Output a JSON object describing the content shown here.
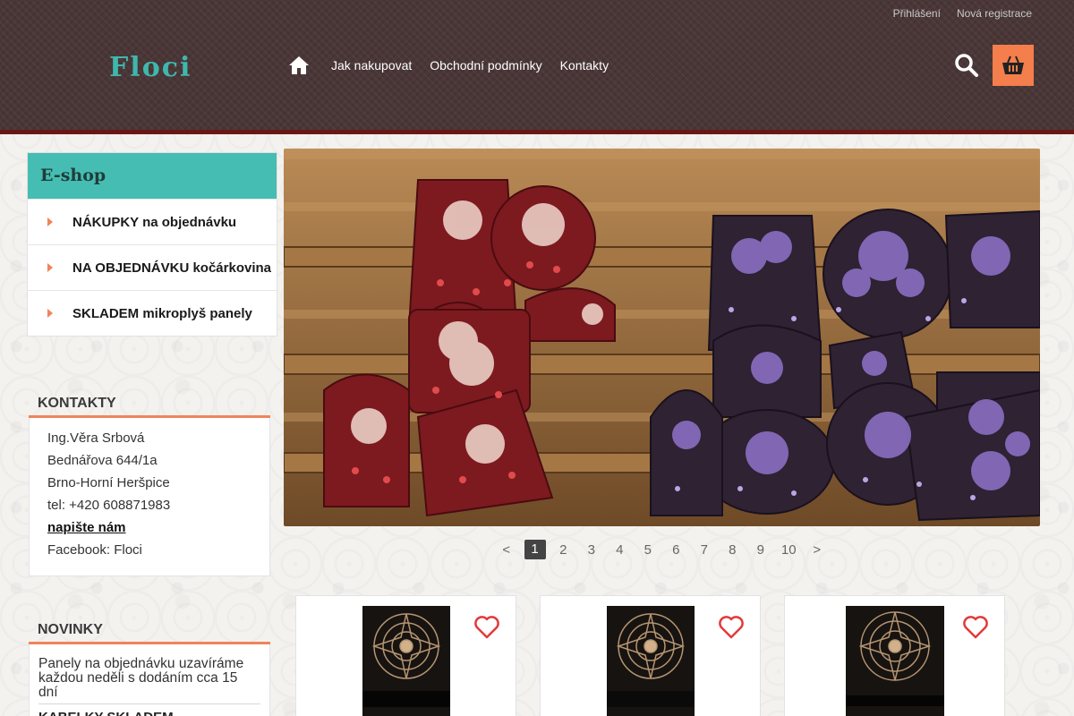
{
  "header": {
    "top_links": [
      "Přihlášení",
      "Nová registrace"
    ],
    "logo": "Floci",
    "nav": [
      "Jak nakupovat",
      "Obchodní podmínky",
      "Kontakty"
    ]
  },
  "sidebar": {
    "eshop_title": "E-shop",
    "eshop_items": [
      {
        "label": "NÁKUPKY na objednávku"
      },
      {
        "label": "NA OBJEDNÁVKU kočárkovina"
      },
      {
        "label": "SKLADEM mikroplyš panely"
      }
    ],
    "contacts": {
      "title": "KONTAKTY",
      "lines": [
        "Ing.Věra Srbová",
        "Bednářova 644/1a",
        "Brno-Horní Heršpice",
        "tel: +420 608871983"
      ],
      "write_link": "napište nám",
      "facebook": "Facebook: Floci"
    },
    "news": {
      "title": "NOVINKY",
      "items": [
        "Panely na objednávku uzavíráme každou neděli s dodáním cca 15 dní",
        "KABELKY SKLADEM"
      ]
    }
  },
  "pager": {
    "prev": "<",
    "pages": [
      "1",
      "2",
      "3",
      "4",
      "5",
      "6",
      "7",
      "8",
      "9",
      "10"
    ],
    "current": "1",
    "next": ">"
  },
  "colors": {
    "accent": "#46bdb2",
    "orange": "#f47e4c",
    "header_bg": "#4a3636",
    "header_border": "#6b1616",
    "heart": "#e23a3a"
  },
  "icons": [
    "home-icon",
    "search-icon",
    "basket-icon",
    "heart-icon"
  ]
}
